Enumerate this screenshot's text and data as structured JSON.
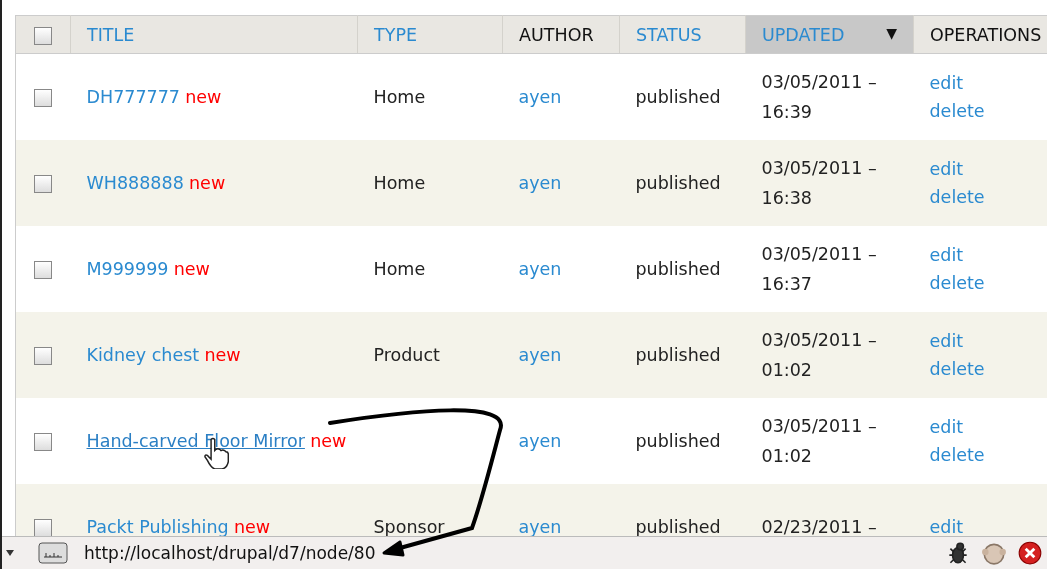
{
  "table": {
    "select_all": {
      "checked": false
    },
    "columns": [
      {
        "label": "TITLE",
        "sortable": true,
        "selected": false
      },
      {
        "label": "TYPE",
        "sortable": true,
        "selected": false
      },
      {
        "label": "AUTHOR",
        "sortable": false,
        "selected": false
      },
      {
        "label": "STATUS",
        "sortable": true,
        "selected": false
      },
      {
        "label": "UPDATED",
        "sortable": true,
        "selected": true,
        "sort_icon": "▼"
      },
      {
        "label": "OPERATIONS",
        "sortable": false,
        "selected": false
      }
    ],
    "rows": [
      {
        "checked": false,
        "title": "DH777777",
        "badge": "new",
        "hovered": false,
        "type": "Home",
        "author": "ayen",
        "status": "published",
        "updated": "03/05/2011 – 16:39",
        "operations": [
          "edit",
          "delete"
        ]
      },
      {
        "checked": false,
        "title": "WH888888",
        "badge": "new",
        "hovered": false,
        "type": "Home",
        "author": "ayen",
        "status": "published",
        "updated": "03/05/2011 – 16:38",
        "operations": [
          "edit",
          "delete"
        ]
      },
      {
        "checked": false,
        "title": "M999999",
        "badge": "new",
        "hovered": false,
        "type": "Home",
        "author": "ayen",
        "status": "published",
        "updated": "03/05/2011 – 16:37",
        "operations": [
          "edit",
          "delete"
        ]
      },
      {
        "checked": false,
        "title": "Kidney chest",
        "badge": "new",
        "hovered": false,
        "type": "Product",
        "author": "ayen",
        "status": "published",
        "updated": "03/05/2011 – 01:02",
        "operations": [
          "edit",
          "delete"
        ]
      },
      {
        "checked": false,
        "title": "Hand-carved Floor Mirror",
        "badge": "new",
        "hovered": true,
        "author": "ayen",
        "status": "published",
        "updated": "03/05/2011 – 01:02",
        "operations": [
          "edit",
          "delete"
        ]
      },
      {
        "checked": false,
        "title": "Packt Publishing",
        "badge": "new",
        "hovered": false,
        "type": "Sponsor",
        "author": "ayen",
        "status": "published",
        "updated": "02/23/2011 –",
        "operations": [
          "edit"
        ]
      }
    ]
  },
  "status_bar": {
    "url": "http://localhost/drupal/d7/node/80"
  }
}
